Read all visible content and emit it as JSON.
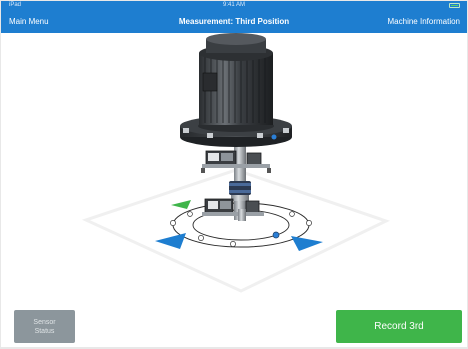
{
  "statusbar": {
    "left": "iPad",
    "center": "9:41 AM",
    "right": "100%"
  },
  "header": {
    "back_label": "Main Menu",
    "title": "Measurement: Third Position",
    "right_label": "Machine Information"
  },
  "footer": {
    "sensor_status_line1": "Sensor",
    "sensor_status_line2": "Status",
    "record_label": "Record 3rd"
  },
  "colors": {
    "header_bg": "#1e7ed0",
    "record_button": "#3fb54a",
    "sensor_button": "#8c969c",
    "arrow_active": "#3fb54a",
    "arrow_inactive": "#1e7ed0"
  },
  "scene": {
    "object": "vertical-motor-with-shaft-sensors",
    "positions": [
      {
        "name": "first",
        "state": "done"
      },
      {
        "name": "second",
        "state": "done"
      },
      {
        "name": "third",
        "state": "current"
      }
    ]
  }
}
